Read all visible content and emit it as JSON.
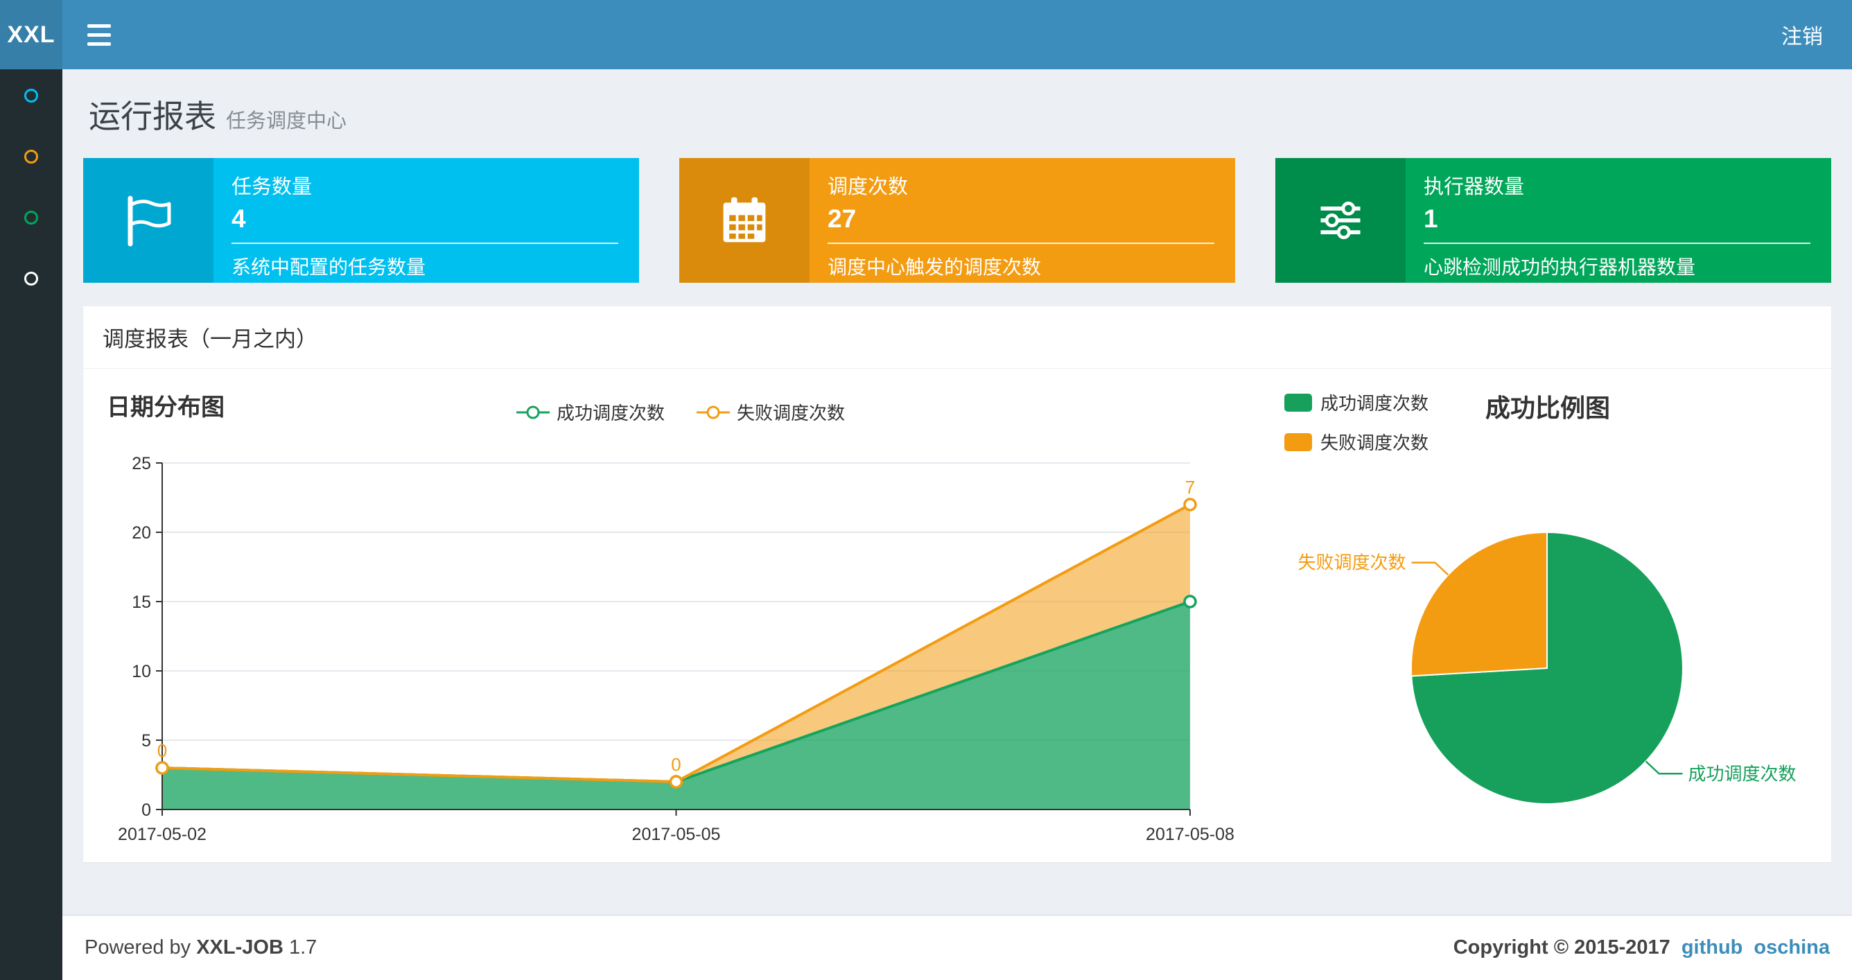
{
  "navbar": {
    "logo": "XXL",
    "logout_label": "注销"
  },
  "sidebar": {
    "items": [
      {
        "id": "item-1",
        "color": "#00c0ef"
      },
      {
        "id": "item-2",
        "color": "#f39c12"
      },
      {
        "id": "item-3",
        "color": "#00a65a"
      },
      {
        "id": "item-4",
        "color": "#ffffff"
      }
    ]
  },
  "header": {
    "title": "运行报表",
    "subtitle": "任务调度中心"
  },
  "info_boxes": [
    {
      "title": "任务数量",
      "value": "4",
      "desc": "系统中配置的任务数量",
      "color": "#00c0ef",
      "color_dark": "#00a7d0",
      "icon": "flag-icon"
    },
    {
      "title": "调度次数",
      "value": "27",
      "desc": "调度中心触发的调度次数",
      "color": "#f39c12",
      "color_dark": "#db8b0b",
      "icon": "calendar-icon"
    },
    {
      "title": "执行器数量",
      "value": "1",
      "desc": "心跳检测成功的执行器机器数量",
      "color": "#00a65a",
      "color_dark": "#008d4c",
      "icon": "sliders-icon"
    }
  ],
  "panel": {
    "title": "调度报表（一月之内）"
  },
  "chart_data": [
    {
      "type": "area",
      "title": "日期分布图",
      "x": [
        "2017-05-02",
        "2017-05-05",
        "2017-05-08"
      ],
      "stacked": true,
      "ylim": [
        0,
        25
      ],
      "yticks": [
        0,
        5,
        10,
        15,
        20,
        25
      ],
      "grid": true,
      "legend_position": "top",
      "series": [
        {
          "name": "成功调度次数",
          "color": "#16a35e",
          "values": [
            3,
            2,
            15
          ]
        },
        {
          "name": "失败调度次数",
          "color": "#f39c12",
          "values": [
            0,
            0,
            7
          ],
          "point_labels": [
            "0",
            "0",
            "7"
          ]
        }
      ]
    },
    {
      "type": "pie",
      "title": "成功比例图",
      "legend_position": "top-left",
      "slices": [
        {
          "name": "成功调度次数",
          "color": "#16a05b",
          "value": 20
        },
        {
          "name": "失败调度次数",
          "color": "#f39c12",
          "value": 7
        }
      ]
    }
  ],
  "footer": {
    "powered_prefix": "Powered by",
    "brand": "XXL-JOB",
    "version": "1.7",
    "copyright": "Copyright © 2015-2017",
    "links": [
      {
        "label": "github"
      },
      {
        "label": "oschina"
      }
    ]
  }
}
